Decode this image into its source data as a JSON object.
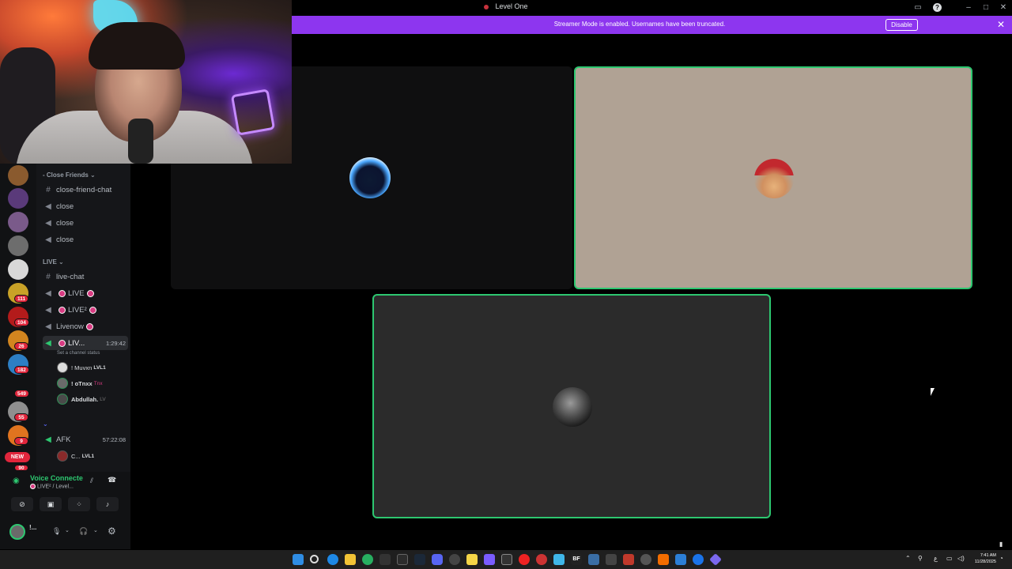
{
  "window": {
    "title": "Level One"
  },
  "banner": {
    "message": "Streamer Mode is enabled. Usernames have been truncated.",
    "disable_label": "Disable"
  },
  "sidebar": {
    "categories": {
      "close_friends": "Close Friends",
      "live": "LIVE"
    },
    "channels": {
      "close_friend_chat": "close-friend-chat",
      "close1": "close",
      "close2": "close",
      "close3": "close",
      "live_chat": "live-chat",
      "live": "LIVE",
      "live2": "LIVE²",
      "livenow": "Livenow",
      "live_active": "LIV...",
      "live_active_timer": "1:29:42",
      "live_active_status": "Set a channel status",
      "afk": "AFK",
      "afk_timer": "57:22:08"
    },
    "members": [
      {
        "name": "! Muvxn",
        "tag": "LVL1"
      },
      {
        "name": "! oTnxx",
        "tag": "Tnx"
      },
      {
        "name": "Abdullah.",
        "tag": "LV"
      }
    ],
    "afk_member": {
      "name": "C...",
      "tag": "LVL1"
    }
  },
  "servers": {
    "badges": [
      "111",
      "104",
      "26",
      "182",
      "549",
      "55",
      "9",
      "90"
    ],
    "new_label": "NEW"
  },
  "voice_panel": {
    "status": "Voice Connecte",
    "channel": "LIVE² / Level...",
    "user_short": "!..."
  },
  "taskbar": {
    "time": "7:41 AM",
    "date": "11/28/2025",
    "lang": "ع"
  },
  "colors": {
    "banner": "#8d36ef",
    "speaking_border": "#2dc770",
    "live_dot": "#d83c82",
    "badge": "#e1263c"
  }
}
